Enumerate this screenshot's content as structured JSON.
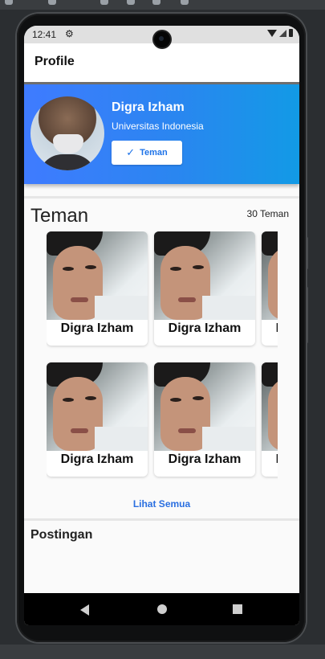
{
  "status_bar": {
    "time": "12:41",
    "settings_icon": "gear-icon"
  },
  "app_bar": {
    "title": "Profile"
  },
  "profile": {
    "name": "Digra Izham",
    "university": "Universitas Indonesia",
    "friend_button_label": "Teman",
    "friend_button_icon": "check-icon"
  },
  "friends_section": {
    "title": "Teman",
    "count_label": "30 Teman",
    "friends": [
      {
        "name": "Digra Izham"
      },
      {
        "name": "Digra Izham"
      },
      {
        "name": "Digra Izham"
      },
      {
        "name": "Digra Izham"
      },
      {
        "name": "Digra Izham"
      },
      {
        "name": "Digra Izham"
      }
    ],
    "see_all_label": "Lihat Semua"
  },
  "posts_section": {
    "title": "Postingan"
  },
  "colors": {
    "hero_gradient_start": "#3f7bff",
    "hero_gradient_end": "#129ae6",
    "accent": "#2a6fe0"
  }
}
